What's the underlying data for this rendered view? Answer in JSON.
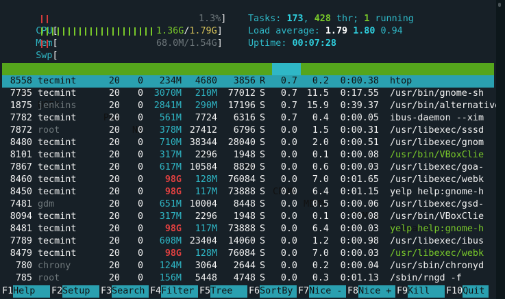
{
  "meters": {
    "cpu": {
      "label": "CPU",
      "text": "1.3%",
      "fill": 0.013
    },
    "mem": {
      "label": "Mem",
      "text_used": "1.36G",
      "text_sep": "/",
      "text_total": "1.79G",
      "fill": 0.76
    },
    "swp": {
      "label": "Swp",
      "text": "68.0M/1.54G",
      "fill": 0.044
    }
  },
  "summary": {
    "tasks_label": "Tasks: ",
    "tasks": "173",
    "tasks_sep": ", ",
    "threads": "428",
    "threads_label": " thr; ",
    "running": "1",
    "running_label": " running",
    "load_label": "Load average: ",
    "load1": "1.79",
    "load5": "1.80",
    "load15": "0.94",
    "uptime_label": "Uptime: ",
    "uptime": "00:07:28"
  },
  "columns": [
    "PID",
    "USER",
    "PRI",
    "NI",
    "VIRT",
    "RES",
    "SHR",
    "S",
    "CPU%",
    "MEM%",
    "TIME+",
    "Command"
  ],
  "processes": [
    {
      "pid": "8558",
      "user": "tecmint",
      "pri": "20",
      "ni": "0",
      "virt": "234M",
      "res": "4680",
      "shr": "3856",
      "s": "R",
      "cpu": "0.7",
      "mem": "0.2",
      "time": "0:00.38",
      "cmd": "htop"
    },
    {
      "pid": "7735",
      "user": "tecmint",
      "pri": "20",
      "ni": "0",
      "virt": "3070M",
      "res": "210M",
      "shr": "77012",
      "s": "S",
      "cpu": "0.7",
      "mem": "11.5",
      "time": "0:17.55",
      "cmd": "/usr/bin/gnome-sh"
    },
    {
      "pid": "1875",
      "user": "jenkins",
      "pri": "20",
      "ni": "0",
      "virt": "2841M",
      "res": "290M",
      "shr": "17196",
      "s": "S",
      "cpu": "0.7",
      "mem": "15.9",
      "time": "0:39.37",
      "cmd": "/usr/bin/alternatives"
    },
    {
      "pid": "7782",
      "user": "tecmint",
      "pri": "20",
      "ni": "0",
      "virt": "561M",
      "res": "7724",
      "shr": "6316",
      "s": "S",
      "cpu": "0.7",
      "mem": "0.4",
      "time": "0:00.05",
      "cmd": "ibus-daemon --xim"
    },
    {
      "pid": "7872",
      "user": "root",
      "pri": "20",
      "ni": "0",
      "virt": "378M",
      "res": "27412",
      "shr": "6796",
      "s": "S",
      "cpu": "0.0",
      "mem": "1.5",
      "time": "0:00.31",
      "cmd": "/usr/libexec/sssd"
    },
    {
      "pid": "8480",
      "user": "tecmint",
      "pri": "20",
      "ni": "0",
      "virt": "710M",
      "res": "38344",
      "shr": "28040",
      "s": "S",
      "cpu": "0.0",
      "mem": "2.0",
      "time": "0:00.51",
      "cmd": "/usr/libexec/gnom"
    },
    {
      "pid": "8101",
      "user": "tecmint",
      "pri": "20",
      "ni": "0",
      "virt": "317M",
      "res": "2296",
      "shr": "1948",
      "s": "S",
      "cpu": "0.0",
      "mem": "0.1",
      "time": "0:00.08",
      "cmd": "/usr/bin/VBoxClie"
    },
    {
      "pid": "7867",
      "user": "tecmint",
      "pri": "20",
      "ni": "0",
      "virt": "617M",
      "res": "10584",
      "shr": "8820",
      "s": "S",
      "cpu": "0.0",
      "mem": "0.6",
      "time": "0:00.03",
      "cmd": "/usr/libexec/goa-"
    },
    {
      "pid": "8460",
      "user": "tecmint",
      "pri": "20",
      "ni": "0",
      "virt": "98G",
      "res": "128M",
      "shr": "76084",
      "s": "S",
      "cpu": "0.0",
      "mem": "7.0",
      "time": "0:01.65",
      "cmd": "/usr/libexec/webk"
    },
    {
      "pid": "8450",
      "user": "tecmint",
      "pri": "20",
      "ni": "0",
      "virt": "98G",
      "res": "117M",
      "shr": "73888",
      "s": "S",
      "cpu": "0.0",
      "mem": "6.4",
      "time": "0:01.15",
      "cmd": "yelp help:gnome-h"
    },
    {
      "pid": "7481",
      "user": "gdm",
      "pri": "20",
      "ni": "0",
      "virt": "651M",
      "res": "10004",
      "shr": "8448",
      "s": "S",
      "cpu": "0.0",
      "mem": "0.5",
      "time": "0:00.06",
      "cmd": "/usr/libexec/gsd-"
    },
    {
      "pid": "8094",
      "user": "tecmint",
      "pri": "20",
      "ni": "0",
      "virt": "317M",
      "res": "2296",
      "shr": "1948",
      "s": "S",
      "cpu": "0.0",
      "mem": "0.1",
      "time": "0:00.08",
      "cmd": "/usr/bin/VBoxClie"
    },
    {
      "pid": "8481",
      "user": "tecmint",
      "pri": "20",
      "ni": "0",
      "virt": "98G",
      "res": "117M",
      "shr": "73888",
      "s": "S",
      "cpu": "0.0",
      "mem": "6.4",
      "time": "0:00.03",
      "cmd": "yelp help:gnome-h"
    },
    {
      "pid": "7789",
      "user": "tecmint",
      "pri": "20",
      "ni": "0",
      "virt": "608M",
      "res": "23404",
      "shr": "14060",
      "s": "S",
      "cpu": "0.0",
      "mem": "1.2",
      "time": "0:00.98",
      "cmd": "/usr/libexec/ibus"
    },
    {
      "pid": "8479",
      "user": "tecmint",
      "pri": "20",
      "ni": "0",
      "virt": "98G",
      "res": "128M",
      "shr": "76084",
      "s": "S",
      "cpu": "0.0",
      "mem": "7.0",
      "time": "0:00.03",
      "cmd": "/usr/libexec/webk"
    },
    {
      "pid": "780",
      "user": "chrony",
      "pri": "20",
      "ni": "0",
      "virt": "124M",
      "res": "3064",
      "shr": "2644",
      "s": "S",
      "cpu": "0.0",
      "mem": "0.2",
      "time": "0:00.04",
      "cmd": "/usr/sbin/chronyd"
    },
    {
      "pid": "785",
      "user": "root",
      "pri": "20",
      "ni": "0",
      "virt": "156M",
      "res": "5448",
      "shr": "4748",
      "s": "S",
      "cpu": "0.0",
      "mem": "0.3",
      "time": "0:01.13",
      "cmd": "/sbin/rngd -f"
    }
  ],
  "fkeys": [
    {
      "key": "F1",
      "label": "Help"
    },
    {
      "key": "F2",
      "label": "Setup"
    },
    {
      "key": "F3",
      "label": "Search"
    },
    {
      "key": "F4",
      "label": "Filter"
    },
    {
      "key": "F5",
      "label": "Tree"
    },
    {
      "key": "F6",
      "label": "SortBy"
    },
    {
      "key": "F7",
      "label": "Nice -"
    },
    {
      "key": "F8",
      "label": "Nice +"
    },
    {
      "key": "F9",
      "label": "Kill"
    },
    {
      "key": "F10",
      "label": "Quit"
    }
  ],
  "colors": {
    "background": "#172027",
    "header": "#55a51c",
    "selected": "#2aa0b0",
    "cyan": "#2fb7c6",
    "green": "#79c92a",
    "red": "#d43b3b",
    "dim": "#6d767a"
  }
}
